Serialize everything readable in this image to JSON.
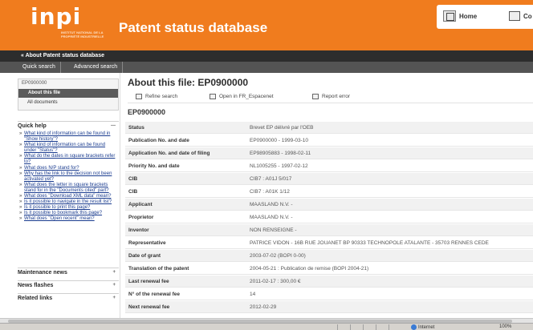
{
  "header": {
    "logo_text": "inpi",
    "logo_subtext": "INSTITUT NATIONAL DE LA PROPRIÉTÉ INDUSTRIELLE",
    "site_title": "Patent status database",
    "home_label": "Home",
    "contact_label": "Co"
  },
  "subnav": {
    "back_label": "« About Patent status database"
  },
  "tabs": [
    {
      "label": "Quick search"
    },
    {
      "label": "Advanced search"
    }
  ],
  "sidebar": {
    "doc_id": "EP0900000",
    "about_label": "About this file",
    "all_label": "All documents",
    "quick_help_label": "Quick help",
    "quick_help_items": [
      "What kind of information can be found in \"Show history\"?",
      "What kind of information can be found under \"Status\"?",
      "What do the dates in square brackets refer to?",
      "What does N/P stand for?",
      "Why has the link to the decision not been activated yet?",
      "What does the letter in square brackets stand for in the \"Documents cited\" part?",
      "What does \"Download XML data\" mean?",
      "Is it possible to navigate in the result list?",
      "Is it possible to print this page?",
      "Is it possible to bookmark this page?",
      "What does \"Open recent\" mean?"
    ],
    "panels": [
      {
        "label": "Maintenance news"
      },
      {
        "label": "News flashes"
      },
      {
        "label": "Related links"
      }
    ]
  },
  "main": {
    "title": "About this file: EP0900000",
    "actions": [
      {
        "label": "Refine search",
        "icon": "refine-search-icon"
      },
      {
        "label": "Open in FR_Espacenet",
        "icon": "espacenet-icon"
      },
      {
        "label": "Report error",
        "icon": "report-error-icon"
      }
    ],
    "doc_number": "EP0900000",
    "rows": [
      {
        "label": "Status",
        "value": "Brevet EP délivré par l'OEB"
      },
      {
        "label": "Publication No. and date",
        "value": "EP0900000 - 1999-03-10"
      },
      {
        "label": "Application No. and date of filing",
        "value": "EP98905883 - 1998-02-11"
      },
      {
        "label": "Priority No. and date",
        "value": "NL1005255 - 1997-02-12"
      },
      {
        "label": "CIB",
        "value": "CIB7 : A01J 5/017"
      },
      {
        "label": "CIB",
        "value": "CIB7 : A01K 1/12"
      },
      {
        "label": "Applicant",
        "value": "MAASLAND N.V. -"
      },
      {
        "label": "Proprietor",
        "value": "MAASLAND N.V. -"
      },
      {
        "label": "Inventor",
        "value": "NON RENSEIGNE -"
      },
      {
        "label": "Representative",
        "value": "PATRICE VIDON - 16B RUE JOUANET BP 90333 TECHNOPOLE ATALANTE - 35703 RENNES CEDE"
      },
      {
        "label": "Date of grant",
        "value": "2003-07-02 (BOPI 0-00)"
      },
      {
        "label": "Translation of the patent",
        "value": "2004-05-21 : Publication de remise (BOPI 2004-21)"
      },
      {
        "label": "Last renewal fee",
        "value": "2011-02-17 : 300,00 €"
      },
      {
        "label": "N° of the renewal fee",
        "value": "14"
      },
      {
        "label": "Next renewal fee",
        "value": "2012-02-29"
      }
    ]
  },
  "statusbar": {
    "zone_label": "Internet",
    "zoom_label": "100%"
  }
}
